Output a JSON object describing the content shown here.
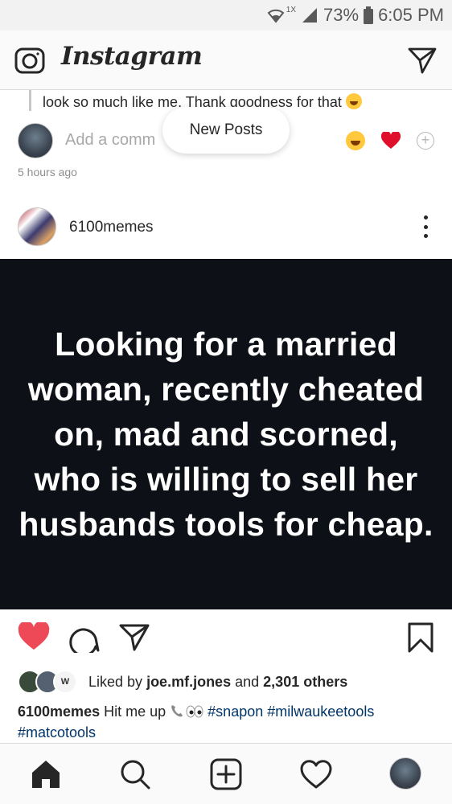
{
  "status_bar": {
    "network_label": "1X",
    "battery": "73%",
    "time": "6:05 PM",
    "icons": [
      "wifi-icon",
      "signal-icon",
      "battery-icon"
    ]
  },
  "header": {
    "app_title": "Instagram",
    "left_icon": "camera-icon",
    "right_icon": "direct-message-icon"
  },
  "previous_post": {
    "comment_text": "look so much like me. Thank goodness for that",
    "add_comment_placeholder": "Add a comm",
    "timestamp": "5 hours ago",
    "quick_reactions": [
      "laughing-emoji-icon",
      "heart-emoji-icon",
      "add-emoji-icon"
    ]
  },
  "new_posts_pill": "New Posts",
  "post": {
    "username": "6100memes",
    "image_text": "Looking for a married woman, recently cheated on, mad and scorned, who is willing to sell her husbands tools for cheap.",
    "liked": {
      "prefix": "Liked by",
      "user": "joe.mf.jones",
      "middle": "and",
      "count": "2,301 others",
      "avatar_badge": "W"
    },
    "caption": {
      "username": "6100memes",
      "text": "Hit me up",
      "tags": [
        "#snapon",
        "#milwaukeetools",
        "#matcotools"
      ]
    },
    "liked_state": true,
    "accent_color": "#ed4956"
  },
  "bottom_nav": {
    "items": [
      "home-icon",
      "search-icon",
      "new-post-icon",
      "activity-icon",
      "profile-avatar"
    ],
    "active": "home-icon"
  }
}
